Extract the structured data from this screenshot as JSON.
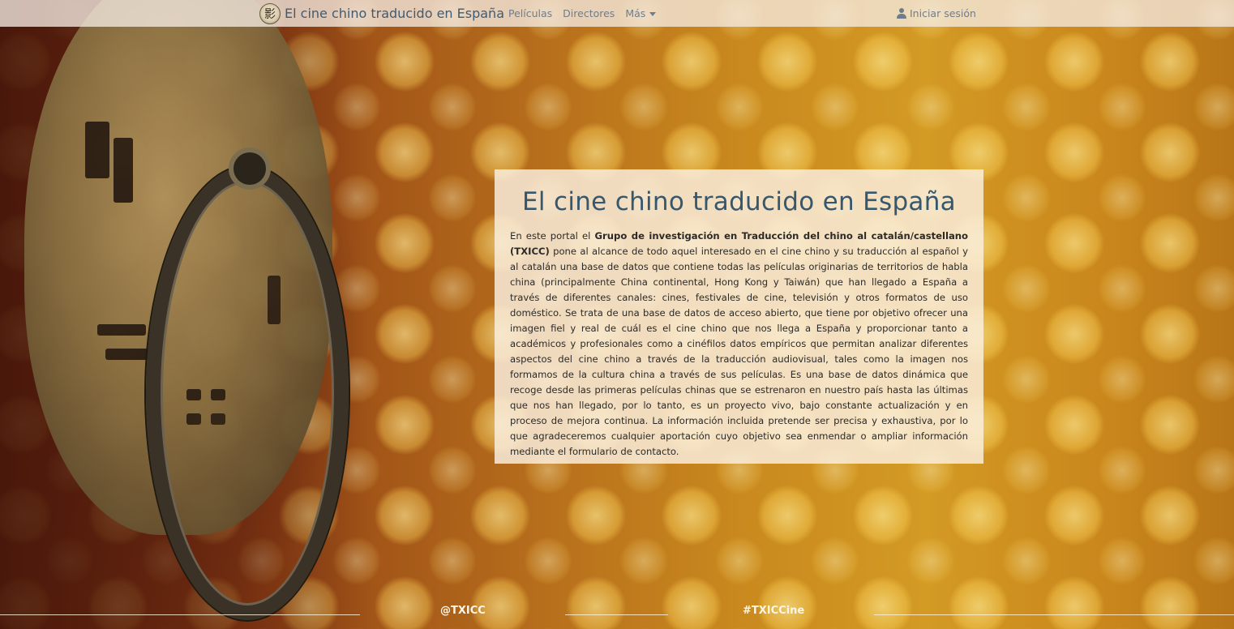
{
  "navbar": {
    "brand": "El cine chino traducido en España",
    "links": {
      "films": "Películas",
      "directors": "Directores",
      "more": "Más"
    },
    "login": "Iniciar sesión"
  },
  "card": {
    "title": "El cine chino traducido en España",
    "intro": "En este portal el ",
    "group": "Grupo de investigación en Traducción del chino al catalán/castellano (TXICC)",
    "body": " pone al alcance de todo aquel interesado en el cine chino y su traducción al español y al catalán una base de datos que contiene todas las películas originarias de territorios de habla china (principalmente China continental, Hong Kong y Taiwán) que han llegado a España a través de diferentes canales: cines, festivales de cine, televisión y otros formatos de uso doméstico. Se trata de una base de datos de acceso abierto, que tiene por objetivo ofrecer una imagen fiel y real de cuál es el cine chino que nos llega a España y proporcionar tanto a académicos y profesionales como a cinéfilos datos empíricos que permitan analizar diferentes aspectos del cine chino a través de la traducción audiovisual, tales como la imagen nos formamos de la cultura china a través de sus películas. Es una base de datos dinámica que recoge desde las primeras películas chinas que se estrenaron en nuestro país hasta las últimas que nos han llegado, por lo tanto, es un proyecto vivo, bajo constante actualización y en proceso de mejora continua. La información incluida pretende ser precisa y exhaustiva, por lo que agradeceremos cualquier aportación cuyo objetivo sea enmendar o ampliar información mediante el formulario de contacto."
  },
  "footer": {
    "twitter_handle": "@TXICC",
    "hashtag": "#TXICCine"
  },
  "colors": {
    "title": "#35586f",
    "nav_text": "#6f7d8a"
  }
}
